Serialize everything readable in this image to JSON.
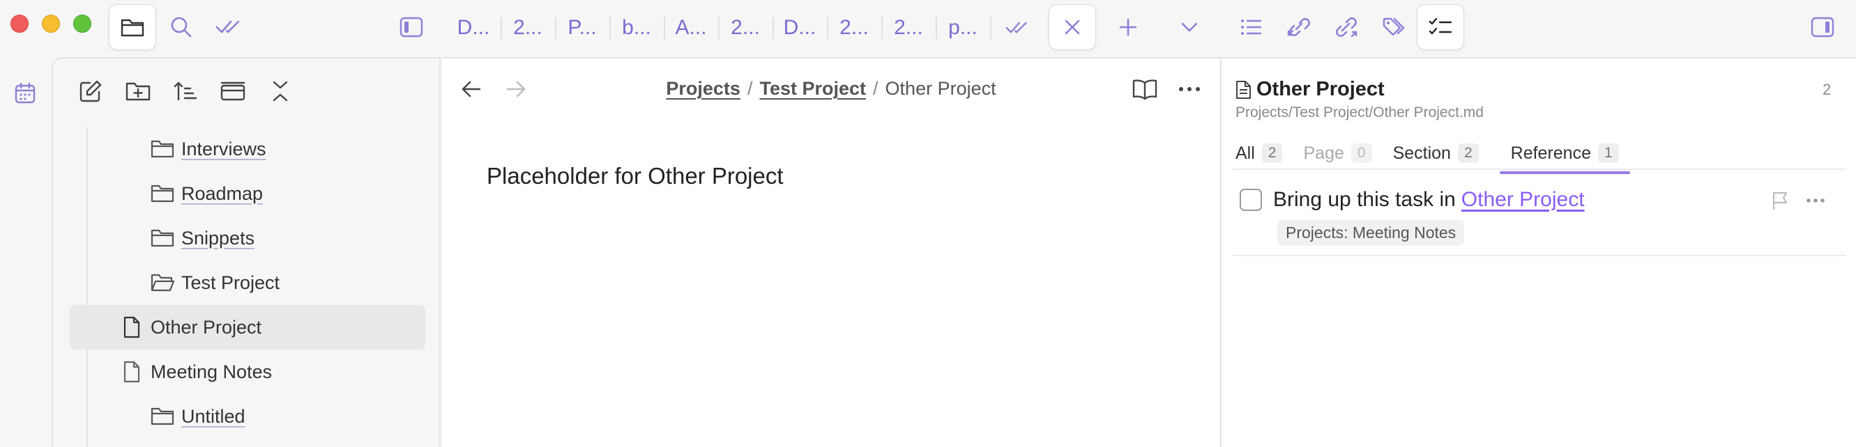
{
  "titlebar": {
    "tabs": [
      {
        "label": "D..."
      },
      {
        "label": "2..."
      },
      {
        "label": "P..."
      },
      {
        "label": "b..."
      },
      {
        "label": "A..."
      },
      {
        "label": "2..."
      },
      {
        "label": "D..."
      },
      {
        "label": "2..."
      },
      {
        "label": "2..."
      },
      {
        "label": "p..."
      }
    ]
  },
  "colors": {
    "accent": "#8b5cf6",
    "tab_text": "#7c6bd2",
    "close_red": "#ee5d5b",
    "minimize_yellow": "#f5bd2f",
    "zoom_green": "#5fc43c"
  },
  "explorer": {
    "items": [
      {
        "label": "Interviews",
        "type": "folder",
        "open": false
      },
      {
        "label": "Roadmap",
        "type": "folder",
        "open": false
      },
      {
        "label": "Snippets",
        "type": "folder",
        "open": false
      },
      {
        "label": "Test Project",
        "type": "folder",
        "open": true
      },
      {
        "label": "Other Project",
        "type": "file",
        "active": true
      },
      {
        "label": "Meeting Notes",
        "type": "file"
      },
      {
        "label": "Untitled",
        "type": "folder",
        "open": false
      }
    ]
  },
  "editor": {
    "breadcrumb": [
      "Projects",
      "Test Project",
      "Other Project"
    ],
    "breadcrumb_sep": "/",
    "body_text": "Placeholder for Other Project"
  },
  "backlinks": {
    "title": "Other Project",
    "count": "2",
    "path": "Projects/Test Project/Other Project.md",
    "tabs": [
      {
        "label": "All",
        "count": "2"
      },
      {
        "label": "Page",
        "count": "0"
      },
      {
        "label": "Section",
        "count": "2"
      },
      {
        "label": "Reference",
        "count": "1"
      }
    ],
    "task": {
      "text": "Bring up this task in",
      "link": "Other Project",
      "meta": "Projects: Meeting Notes"
    }
  }
}
